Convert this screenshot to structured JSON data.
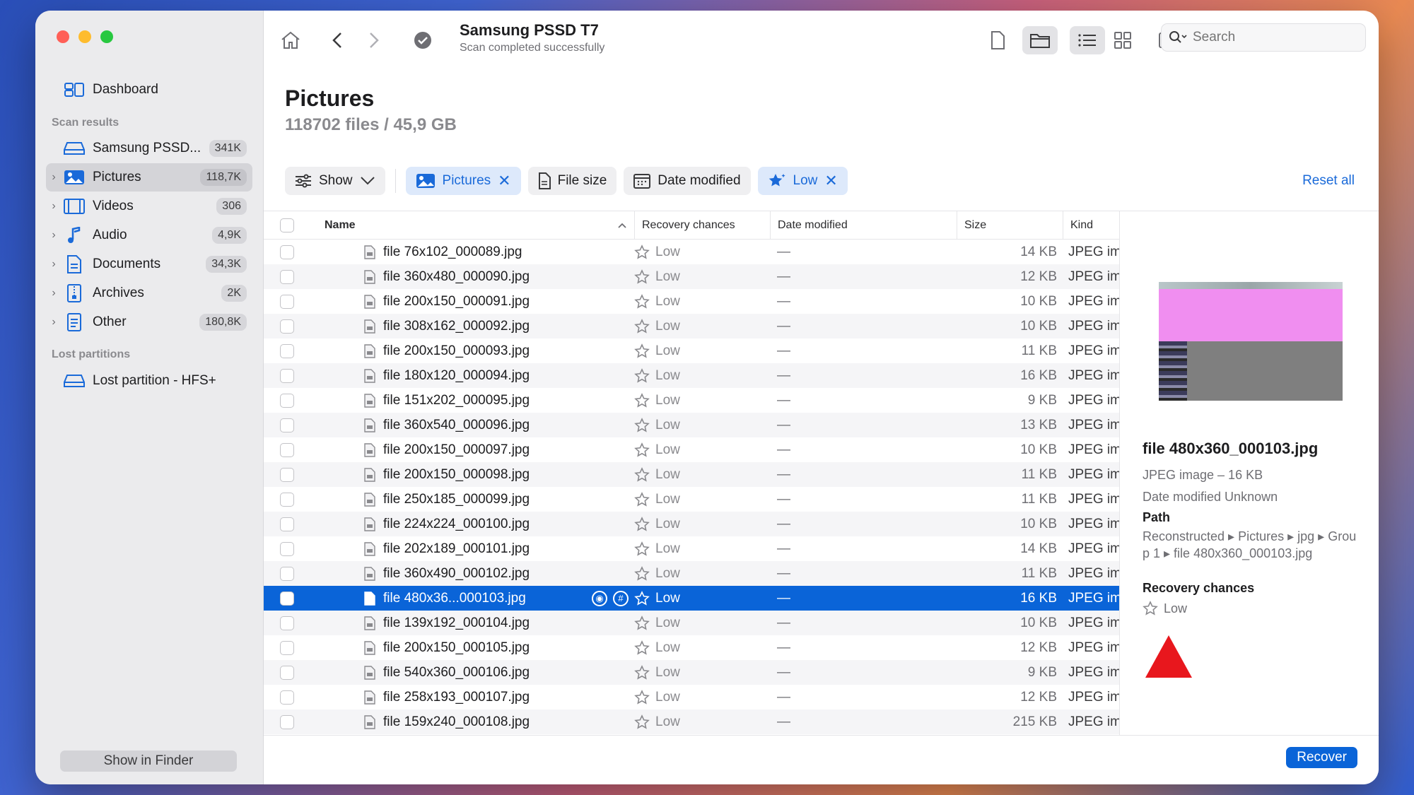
{
  "window": {
    "title": "Samsung PSSD T7",
    "subtitle": "Scan completed successfully"
  },
  "sidebar": {
    "dashboard_label": "Dashboard",
    "scan_results_header": "Scan results",
    "lost_partitions_header": "Lost partitions",
    "items": [
      {
        "label": "Samsung PSSD...",
        "badge": "341K",
        "icon": "drive-icon"
      },
      {
        "label": "Pictures",
        "badge": "118,7K",
        "icon": "pictures-icon"
      },
      {
        "label": "Videos",
        "badge": "306",
        "icon": "videos-icon"
      },
      {
        "label": "Audio",
        "badge": "4,9K",
        "icon": "audio-icon"
      },
      {
        "label": "Documents",
        "badge": "34,3K",
        "icon": "documents-icon"
      },
      {
        "label": "Archives",
        "badge": "2K",
        "icon": "archives-icon"
      },
      {
        "label": "Other",
        "badge": "180,8K",
        "icon": "other-icon"
      }
    ],
    "lost_partition_label": "Lost partition - HFS+",
    "show_in_finder": "Show in Finder"
  },
  "toolbar": {
    "search_placeholder": "Search"
  },
  "content": {
    "title": "Pictures",
    "summary": "118702 files / 45,9 GB",
    "filters": {
      "show": "Show",
      "pictures": "Pictures",
      "file_size": "File size",
      "date_modified": "Date modified",
      "low": "Low"
    },
    "reset_all": "Reset all"
  },
  "table": {
    "columns": {
      "name": "Name",
      "recovery": "Recovery chances",
      "date": "Date modified",
      "size": "Size",
      "kind": "Kind"
    },
    "rows": [
      {
        "name": "file 76x102_000089.jpg",
        "recovery": "Low",
        "date": "—",
        "size": "14 KB",
        "kind": "JPEG ima..."
      },
      {
        "name": "file 360x480_000090.jpg",
        "recovery": "Low",
        "date": "—",
        "size": "12 KB",
        "kind": "JPEG ima..."
      },
      {
        "name": "file 200x150_000091.jpg",
        "recovery": "Low",
        "date": "—",
        "size": "10 KB",
        "kind": "JPEG ima..."
      },
      {
        "name": "file 308x162_000092.jpg",
        "recovery": "Low",
        "date": "—",
        "size": "10 KB",
        "kind": "JPEG ima..."
      },
      {
        "name": "file 200x150_000093.jpg",
        "recovery": "Low",
        "date": "—",
        "size": "11 KB",
        "kind": "JPEG ima..."
      },
      {
        "name": "file 180x120_000094.jpg",
        "recovery": "Low",
        "date": "—",
        "size": "16 KB",
        "kind": "JPEG ima..."
      },
      {
        "name": "file 151x202_000095.jpg",
        "recovery": "Low",
        "date": "—",
        "size": "9 KB",
        "kind": "JPEG ima..."
      },
      {
        "name": "file 360x540_000096.jpg",
        "recovery": "Low",
        "date": "—",
        "size": "13 KB",
        "kind": "JPEG ima..."
      },
      {
        "name": "file 200x150_000097.jpg",
        "recovery": "Low",
        "date": "—",
        "size": "10 KB",
        "kind": "JPEG ima..."
      },
      {
        "name": "file 200x150_000098.jpg",
        "recovery": "Low",
        "date": "—",
        "size": "11 KB",
        "kind": "JPEG ima..."
      },
      {
        "name": "file 250x185_000099.jpg",
        "recovery": "Low",
        "date": "—",
        "size": "11 KB",
        "kind": "JPEG ima..."
      },
      {
        "name": "file 224x224_000100.jpg",
        "recovery": "Low",
        "date": "—",
        "size": "10 KB",
        "kind": "JPEG ima..."
      },
      {
        "name": "file 202x189_000101.jpg",
        "recovery": "Low",
        "date": "—",
        "size": "14 KB",
        "kind": "JPEG ima..."
      },
      {
        "name": "file 360x490_000102.jpg",
        "recovery": "Low",
        "date": "—",
        "size": "11 KB",
        "kind": "JPEG ima..."
      },
      {
        "name": "file 480x36...000103.jpg",
        "recovery": "Low",
        "date": "—",
        "size": "16 KB",
        "kind": "JPEG ima...",
        "selected": true
      },
      {
        "name": "file 139x192_000104.jpg",
        "recovery": "Low",
        "date": "—",
        "size": "10 KB",
        "kind": "JPEG ima..."
      },
      {
        "name": "file 200x150_000105.jpg",
        "recovery": "Low",
        "date": "—",
        "size": "12 KB",
        "kind": "JPEG ima..."
      },
      {
        "name": "file 540x360_000106.jpg",
        "recovery": "Low",
        "date": "—",
        "size": "9 KB",
        "kind": "JPEG ima..."
      },
      {
        "name": "file 258x193_000107.jpg",
        "recovery": "Low",
        "date": "—",
        "size": "12 KB",
        "kind": "JPEG ima..."
      },
      {
        "name": "file 159x240_000108.jpg",
        "recovery": "Low",
        "date": "—",
        "size": "215 KB",
        "kind": "JPEG ima..."
      }
    ]
  },
  "preview": {
    "file_name": "file 480x360_000103.jpg",
    "type_size": "JPEG image – 16 KB",
    "date_modified": "Date modified  Unknown",
    "path_header": "Path",
    "path": "Reconstructed ▸ Pictures ▸ jpg ▸ Group 1 ▸ file 480x360_000103.jpg",
    "recovery_header": "Recovery chances",
    "recovery_value": "Low"
  },
  "footer": {
    "recover_label": "Recover"
  },
  "colors": {
    "accent": "#0a64d8",
    "selection": "#0a64d8",
    "annotation_arrow": "#e8171d"
  }
}
